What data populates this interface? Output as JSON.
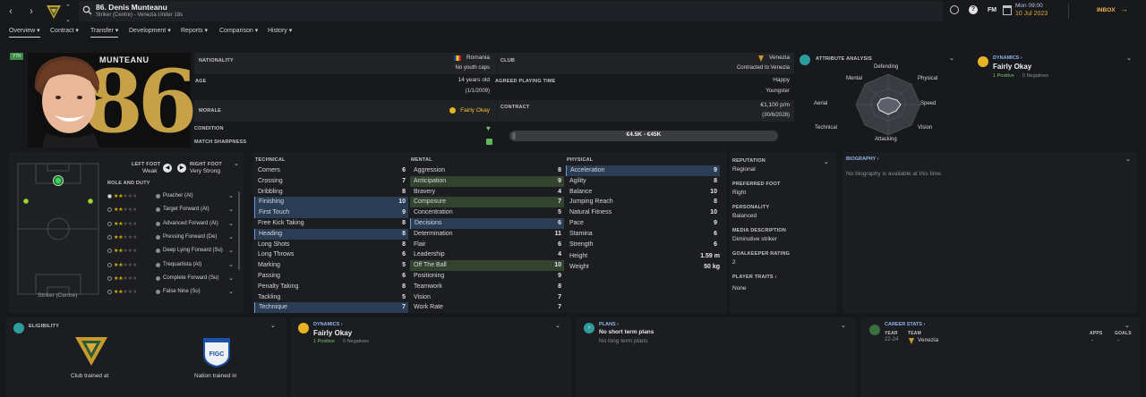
{
  "header": {
    "player_title": "86. Denis Munteanu",
    "player_subtitle": "Striker (Centre) - Venezia Under 18s",
    "fm_label": "FM",
    "time": "Mon 09:00",
    "date": "10 Jul 2023",
    "inbox_label": "INBOX"
  },
  "tabs": [
    "Overview",
    "Contract",
    "Transfer",
    "Development",
    "Reports",
    "Comparison",
    "History"
  ],
  "profile": {
    "badge": "YTh",
    "surname": "MUNTEANU",
    "number": "86",
    "nationality_label": "NATIONALITY",
    "nationality": "Romania",
    "youth_caps": "No youth caps",
    "age_label": "AGE",
    "age": "14 years old",
    "dob": "(1/1/2009)",
    "morale_label": "MORALE",
    "morale": "Fairly Okay",
    "condition_label": "CONDITION",
    "sharpness_label": "MATCH SHARPNESS",
    "club_label": "CLUB",
    "club": "Venezia",
    "contract_note": "Contracted to Venezia",
    "agreed_time_label": "AGREED PLAYING TIME",
    "playing_time": "Happy",
    "playing_role": "Youngster",
    "contract_label": "CONTRACT",
    "wage": "€1,100 p/m",
    "contract_end": "(30/6/2028)",
    "value_range": "€4.5K - €45K"
  },
  "attribute_analysis": {
    "title": "ATTRIBUTE ANALYSIS",
    "axes": [
      "Defending",
      "Physical",
      "Speed",
      "Vision",
      "Attacking",
      "Technical",
      "Aerial",
      "Mental"
    ]
  },
  "dynamics_top": {
    "title": "DYNAMICS",
    "status": "Fairly Okay",
    "positives": "1 Positive",
    "negatives": "0 Negatives"
  },
  "pitch": {
    "position_label": "Striker (Centre)",
    "left_foot_label": "LEFT FOOT",
    "left_foot": "Weak",
    "right_foot_label": "RIGHT FOOT",
    "right_foot": "Very Strong",
    "role_duty_label": "ROLE AND DUTY"
  },
  "roles": [
    {
      "name": "Poacher (At)",
      "stars": 1.5
    },
    {
      "name": "Target Forward (At)",
      "stars": 1.5
    },
    {
      "name": "Advanced Forward (At)",
      "stars": 1.5
    },
    {
      "name": "Pressing Forward (De)",
      "stars": 1.5
    },
    {
      "name": "Deep Lying Forward (Su)",
      "stars": 1.5
    },
    {
      "name": "Trequartista (At)",
      "stars": 1.5
    },
    {
      "name": "Complete Forward (Su)",
      "stars": 1.5
    },
    {
      "name": "False Nine (Su)",
      "stars": 1.5
    }
  ],
  "attributes": {
    "technical_label": "TECHNICAL",
    "mental_label": "MENTAL",
    "physical_label": "PHYSICAL",
    "technical": [
      {
        "name": "Corners",
        "value": "6",
        "hl": ""
      },
      {
        "name": "Crossing",
        "value": "7",
        "hl": ""
      },
      {
        "name": "Dribbling",
        "value": "8",
        "hl": ""
      },
      {
        "name": "Finishing",
        "value": "10",
        "hl": "blue"
      },
      {
        "name": "First Touch",
        "value": "9",
        "hl": "blue"
      },
      {
        "name": "Free Kick Taking",
        "value": "8",
        "hl": ""
      },
      {
        "name": "Heading",
        "value": "8",
        "hl": "blue"
      },
      {
        "name": "Long Shots",
        "value": "8",
        "hl": ""
      },
      {
        "name": "Long Throws",
        "value": "6",
        "hl": ""
      },
      {
        "name": "Marking",
        "value": "5",
        "hl": ""
      },
      {
        "name": "Passing",
        "value": "6",
        "hl": ""
      },
      {
        "name": "Penalty Taking",
        "value": "8",
        "hl": ""
      },
      {
        "name": "Tackling",
        "value": "5",
        "hl": ""
      },
      {
        "name": "Technique",
        "value": "7",
        "hl": "blue"
      }
    ],
    "mental": [
      {
        "name": "Aggression",
        "value": "8",
        "hl": ""
      },
      {
        "name": "Anticipation",
        "value": "9",
        "hl": "green"
      },
      {
        "name": "Bravery",
        "value": "4",
        "hl": ""
      },
      {
        "name": "Composure",
        "value": "7",
        "hl": "green"
      },
      {
        "name": "Concentration",
        "value": "5",
        "hl": ""
      },
      {
        "name": "Decisions",
        "value": "6",
        "hl": "blue"
      },
      {
        "name": "Determination",
        "value": "11",
        "hl": "",
        "yellow": true
      },
      {
        "name": "Flair",
        "value": "6",
        "hl": ""
      },
      {
        "name": "Leadership",
        "value": "4",
        "hl": ""
      },
      {
        "name": "Off The Ball",
        "value": "10",
        "hl": "green"
      },
      {
        "name": "Positioning",
        "value": "9",
        "hl": ""
      },
      {
        "name": "Teamwork",
        "value": "8",
        "hl": ""
      },
      {
        "name": "Vision",
        "value": "7",
        "hl": ""
      },
      {
        "name": "Work Rate",
        "value": "7",
        "hl": ""
      }
    ],
    "physical": [
      {
        "name": "Acceleration",
        "value": "9",
        "hl": "blue"
      },
      {
        "name": "Agility",
        "value": "8",
        "hl": ""
      },
      {
        "name": "Balance",
        "value": "10",
        "hl": ""
      },
      {
        "name": "Jumping Reach",
        "value": "8",
        "hl": ""
      },
      {
        "name": "Natural Fitness",
        "value": "10",
        "hl": ""
      },
      {
        "name": "Pace",
        "value": "9",
        "hl": ""
      },
      {
        "name": "Stamina",
        "value": "6",
        "hl": ""
      },
      {
        "name": "Strength",
        "value": "6",
        "hl": ""
      }
    ],
    "height_label": "Height",
    "height": "1.59 m",
    "weight_label": "Weight",
    "weight": "50 kg"
  },
  "info": {
    "reputation_label": "REPUTATION",
    "reputation": "Regional",
    "preferred_foot_label": "PREFERRED FOOT",
    "preferred_foot": "Right",
    "personality_label": "PERSONALITY",
    "personality": "Balanced",
    "media_label": "MEDIA DESCRIPTION",
    "media": "Diminutive striker",
    "gk_rating_label": "GOALKEEPER RATING",
    "gk_rating": "2",
    "traits_label": "PLAYER TRAITS",
    "traits": "None"
  },
  "biography": {
    "title": "BIOGRAPHY",
    "text": "No biography is available at this time."
  },
  "eligibility": {
    "title": "ELIGIBILITY",
    "club_trained": "Club trained at",
    "nation_trained": "Nation trained in",
    "federation": "FIGC"
  },
  "dynamics_bottom": {
    "title": "DYNAMICS",
    "status": "Fairly Okay",
    "positives": "1 Positive",
    "negatives": "0 Negatives"
  },
  "plans": {
    "title": "PLANS",
    "short": "No short term plans",
    "long": "No long term plans"
  },
  "career": {
    "title": "CAREER STATS",
    "year_label": "YEAR",
    "team_label": "TEAM",
    "apps_label": "APPS",
    "goals_label": "GOALS",
    "year": "22-24",
    "team": "Venezia",
    "apps": "-",
    "goals": "-"
  },
  "colors": {
    "accent_gold": "#d7b24c",
    "positive": "#7bc56f",
    "highlight_blue": "#2b3d55",
    "highlight_green": "#32442f"
  }
}
